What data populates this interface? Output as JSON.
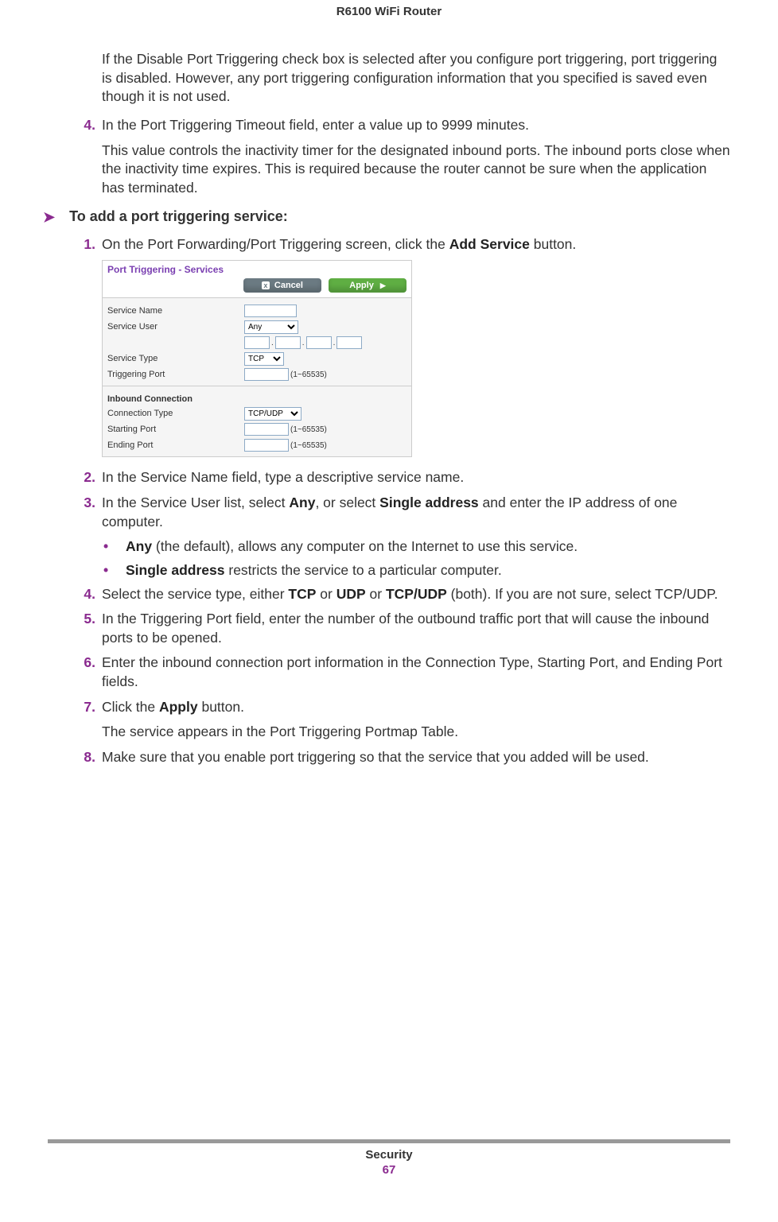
{
  "header": {
    "title": "R6100 WiFi Router"
  },
  "intro_para": "If the Disable Port Triggering check box is selected after you configure port triggering, port triggering is disabled. However, any port triggering configuration information that you specified is saved even though it is not used.",
  "step_pre": {
    "num": "4.",
    "text": "In the Port Triggering Timeout field, enter a value up to 9999 minutes.",
    "note": "This value controls the inactivity timer for the designated inbound ports. The inbound ports close when the inactivity time expires. This is required because the router cannot be sure when the application has terminated."
  },
  "procedure_heading": "To add a port triggering service:",
  "steps": {
    "s1": {
      "num": "1.",
      "pre": "On the Port Forwarding/Port Triggering screen, click the ",
      "bold": "Add Service",
      "post": " button."
    },
    "s2": {
      "num": "2.",
      "text": "In the Service Name field, type a descriptive service name."
    },
    "s3": {
      "num": "3.",
      "pre": "In the Service User list, select ",
      "b1": "Any",
      "mid": ", or select ",
      "b2": "Single address",
      "post": " and enter the IP address of one computer."
    },
    "s3a": {
      "bold": "Any",
      "rest": " (the default), allows any computer on the Internet to use this service."
    },
    "s3b": {
      "bold": "Single address",
      "rest": " restricts the service to a particular computer."
    },
    "s4": {
      "num": "4.",
      "pre": "Select the service type, either ",
      "b1": "TCP",
      "mid1": " or ",
      "b2": "UDP",
      "mid2": " or ",
      "b3": "TCP/UDP",
      "post": " (both). If you are not sure, select TCP/UDP."
    },
    "s5": {
      "num": "5.",
      "text": "In the Triggering Port field, enter the number of the outbound traffic port that will cause the inbound ports to be opened."
    },
    "s6": {
      "num": "6.",
      "text": "Enter the inbound connection port information in the Connection Type, Starting Port, and Ending Port fields."
    },
    "s7": {
      "num": "7.",
      "pre": "Click the ",
      "bold": "Apply",
      "post": " button.",
      "note": "The service appears in the Port Triggering Portmap Table."
    },
    "s8": {
      "num": "8.",
      "text": "Make sure that you enable port triggering so that the service that you added will be used."
    }
  },
  "screenshot": {
    "title": "Port Triggering - Services",
    "buttons": {
      "cancel": "Cancel",
      "apply": "Apply"
    },
    "fields": {
      "service_name_label": "Service Name",
      "service_user_label": "Service User",
      "service_user_value": "Any",
      "service_type_label": "Service Type",
      "service_type_value": "TCP",
      "triggering_port_label": "Triggering Port",
      "range1": "(1~65535)",
      "inbound_header": "Inbound Connection",
      "conn_type_label": "Connection Type",
      "conn_type_value": "TCP/UDP",
      "start_port_label": "Starting Port",
      "range2": "(1~65535)",
      "end_port_label": "Ending Port",
      "range3": "(1~65535)"
    }
  },
  "footer": {
    "section": "Security",
    "page": "67"
  }
}
